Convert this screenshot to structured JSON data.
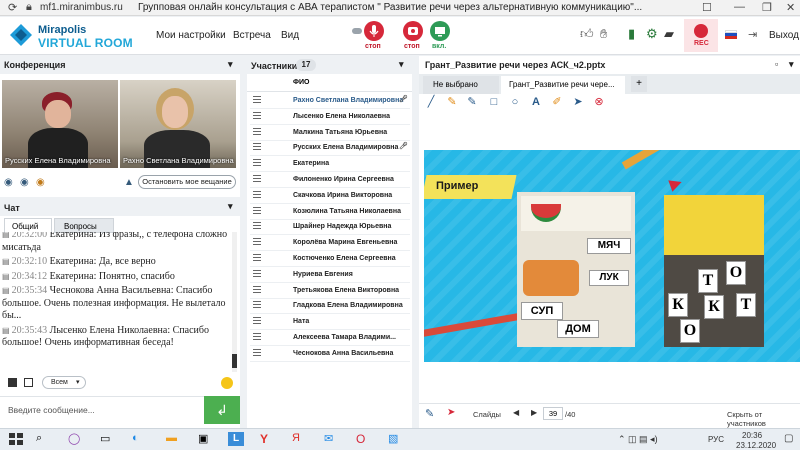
{
  "browser": {
    "url": "mf1.miranimbus.ru",
    "title": "Групповая онлайн консультация с АВА терапистом \" Развитие речи через альтернативную коммуникацию\"..."
  },
  "header": {
    "logo_line1": "Mirapolis",
    "logo_line2": "VIRTUAL ROOM",
    "menu": [
      "Мои настройки",
      "Встреча",
      "Вид"
    ],
    "mic_caption": "стоп",
    "cam_caption": "стоп",
    "screen_caption": "вкл.",
    "rec_caption": "REC",
    "exit_label": "Выход"
  },
  "conference": {
    "title": "Конференция",
    "videos": [
      {
        "name": "Русских Елена Владимировна"
      },
      {
        "name": "Рахно Светлана  Владимировна"
      }
    ],
    "stop_broadcast_label": "Остановить мое вещание"
  },
  "chat": {
    "title": "Чат",
    "tabs": [
      "Общий",
      "Вопросы"
    ],
    "messages": [
      {
        "time": "20:32:00",
        "author": "Екатерина:",
        "text": "Из фразы,, с телефона сложно мисатьда"
      },
      {
        "time": "20:32:10",
        "author": "Екатерина:",
        "text": "Да, все верно"
      },
      {
        "time": "20:34:12",
        "author": "Екатерина:",
        "text": "Понятно, спасибо"
      },
      {
        "time": "20:35:34",
        "author": "Чеснокова  Анна  Васильевна:",
        "text": "Спасибо большое. Очень полезная информация. Не вылетало бы..."
      },
      {
        "time": "20:35:43",
        "author": "Лысенко Елена  Николаевна:",
        "text": "Спасибо большое! Очень информативная беседа!"
      }
    ],
    "recipient": "Всем",
    "input_placeholder": "Введите сообщение..."
  },
  "participants": {
    "title": "Участники",
    "count": "17",
    "column_header": "ФИО",
    "list": [
      "Рахно Светлана  Владимировна",
      "Лысенко Елена  Николаевна",
      "Малкина Татьяна  Юрьевна",
      "Русских Елена  Владимировна",
      "Екатерина",
      "Филоненко Ирина  Сергеевна",
      "Скачкова  Ирина Викторовна",
      "Козюлина  Татьяна Николаевна",
      "Шрайнер Надежда  Юрьевна",
      "Королёва Марина Евгеньевна",
      "Костюченко  Елена  Сергеевна",
      "Нуриева Евгения",
      "Третьякова  Елена Викторовна",
      "Гладкова Елена Владимировна",
      "Ната",
      "Алексеева  Тамара  Владими...",
      "Чеснокова  Анна  Васильевна"
    ]
  },
  "presentation": {
    "title": "Грант_Развитие речи через АСК_ч2.pptx",
    "tabs": [
      "Не выбрано",
      "Грант_Развитие речи чере..."
    ],
    "slide_heading": "Пример",
    "slides_label": "Слайды",
    "current_slide": "39",
    "total_slides": "/40",
    "hide_label": "Скрыть от участников",
    "card_words": [
      "СУП",
      "ДОМ",
      "МЯЧ",
      "ЛУК"
    ],
    "letters": [
      "К",
      "О",
      "Т",
      "К",
      "О",
      "Т"
    ]
  },
  "taskbar": {
    "language": "РУС",
    "time": "20:36",
    "date": "23.12.2020"
  },
  "colors": {
    "accent_blue": "#1a9bd7",
    "record_red": "#d6283a",
    "send_green": "#4caf50",
    "slide_bg": "#27b8e6"
  }
}
